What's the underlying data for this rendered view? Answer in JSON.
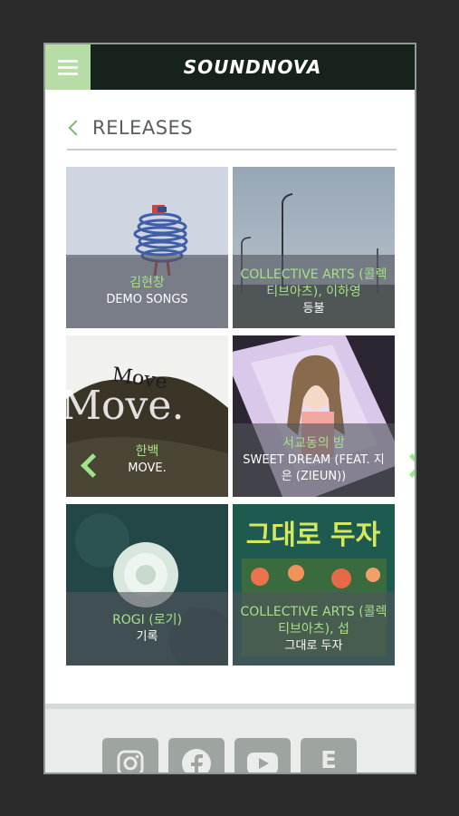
{
  "app": {
    "brand": "SOUNDNOVA"
  },
  "section": {
    "title": "RELEASES"
  },
  "releases": [
    {
      "artist": "김현창",
      "title": "DEMO SONGS"
    },
    {
      "artist": "COLLECTIVE ARTS (콜렉티브아츠), 이하영",
      "title": "등불"
    },
    {
      "artist": "한백",
      "title": "MOVE."
    },
    {
      "artist": "서교동의 밤",
      "title": "SWEET DREAM (FEAT. 지은 (ZIEUN))"
    },
    {
      "artist": "ROGI (로기)",
      "title": "기록"
    },
    {
      "artist": "COLLECTIVE ARTS (콜렉티브아츠), 섭",
      "title": "그대로 두자"
    }
  ],
  "artwork_text": {
    "move_big": "Move.",
    "move_small": "Move",
    "keep_it": "그대로 두자"
  },
  "social": [
    {
      "icon": "instagram-icon"
    },
    {
      "icon": "facebook-icon"
    },
    {
      "icon": "youtube-icon"
    },
    {
      "icon": "e-icon",
      "glyph": "E"
    }
  ],
  "colors": {
    "accent": "#b7dca5",
    "header": "#16231a",
    "artist_text": "#a6e089"
  }
}
